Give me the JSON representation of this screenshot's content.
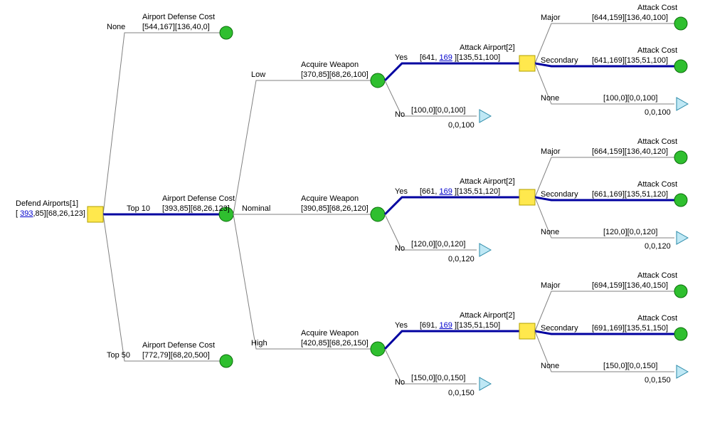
{
  "root": {
    "title": "Defend Airports[1]",
    "value_prefix": "[ ",
    "value_link": "393",
    "value_rest": ",85][68,26,123]"
  },
  "b1": {
    "edge": "None",
    "title": "Airport Defense Cost",
    "values": "[544,167][136,40,0]"
  },
  "b2": {
    "edge": "Top 10",
    "title": "Airport Defense Cost",
    "values": "[393,85][68,26,123]"
  },
  "b3": {
    "edge": "Top 50",
    "title": "Airport Defense Cost",
    "values": "[772,79][68,20,500]"
  },
  "s_low": {
    "edge": "Low",
    "title": "Acquire Weapon",
    "values": "[370,85][68,26,100]"
  },
  "s_nom": {
    "edge": "Nominal",
    "title": "Acquire Weapon",
    "values": "[390,85][68,26,120]"
  },
  "s_high": {
    "edge": "High",
    "title": "Acquire Weapon",
    "values": "[420,85][68,26,150]"
  },
  "aw_low_yes": {
    "edge": "Yes",
    "title": "Attack Airport[2]",
    "values_pref": "[641, ",
    "values_link": "169",
    "values_rest": " ][135,51,100]"
  },
  "aw_low_no": {
    "edge": "No",
    "values": "[100,0][0,0,100]",
    "payoff": "0,0,100"
  },
  "aw_nom_yes": {
    "edge": "Yes",
    "title": "Attack Airport[2]",
    "values_pref": "[661, ",
    "values_link": "169",
    "values_rest": " ][135,51,120]"
  },
  "aw_nom_no": {
    "edge": "No",
    "values": "[120,0][0,0,120]",
    "payoff": "0,0,120"
  },
  "aw_high_yes": {
    "edge": "Yes",
    "title": "Attack Airport[2]",
    "values_pref": "[691, ",
    "values_link": "169",
    "values_rest": " ][135,51,150]"
  },
  "aw_high_no": {
    "edge": "No",
    "values": "[150,0][0,0,150]",
    "payoff": "0,0,150"
  },
  "atk_1_maj": {
    "edge": "Major",
    "title": "Attack Cost",
    "values": "[644,159][136,40,100]"
  },
  "atk_1_sec": {
    "edge": "Secondary",
    "title": "Attack Cost",
    "values": "[641,169][135,51,100]"
  },
  "atk_1_non": {
    "edge": "None",
    "values": "[100,0][0,0,100]",
    "payoff": "0,0,100"
  },
  "atk_2_maj": {
    "edge": "Major",
    "title": "Attack Cost",
    "values": "[664,159][136,40,120]"
  },
  "atk_2_sec": {
    "edge": "Secondary",
    "title": "Attack Cost",
    "values": "[661,169][135,51,120]"
  },
  "atk_2_non": {
    "edge": "None",
    "values": "[120,0][0,0,120]",
    "payoff": "0,0,120"
  },
  "atk_3_maj": {
    "edge": "Major",
    "title": "Attack Cost",
    "values": "[694,159][136,40,150]"
  },
  "atk_3_sec": {
    "edge": "Secondary",
    "title": "Attack Cost",
    "values": "[691,169][135,51,150]"
  },
  "atk_3_non": {
    "edge": "None",
    "values": "[150,0][0,0,150]",
    "payoff": "0,0,150"
  }
}
